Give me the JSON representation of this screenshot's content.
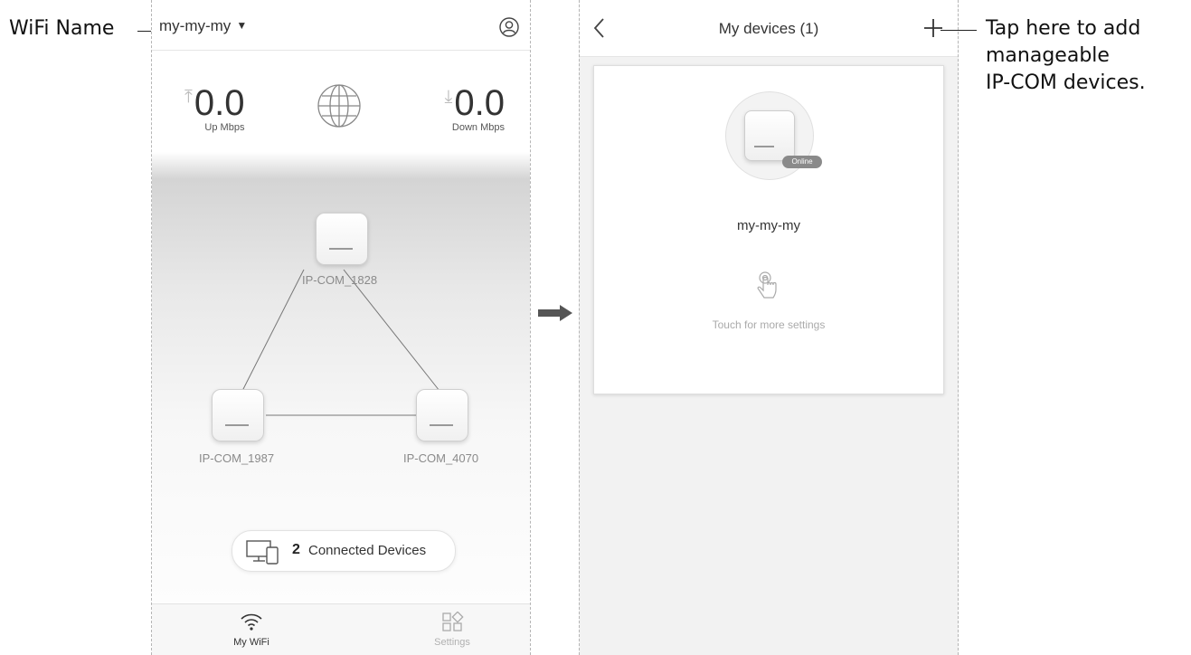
{
  "annotations": {
    "wifi_name_label": "WiFi Name",
    "add_callout": [
      "Tap here to add",
      "manageable",
      "IP-COM devices."
    ]
  },
  "home_screen": {
    "wifi_name": "my-my-my",
    "up_value": "0.0",
    "up_label": "Up Mbps",
    "down_value": "0.0",
    "down_label": "Down Mbps",
    "nodes": [
      {
        "label": "IP-COM_1828"
      },
      {
        "label": "IP-COM_1987"
      },
      {
        "label": "IP-COM_4070"
      }
    ],
    "connected_count": "2",
    "connected_label": "Connected Devices",
    "tabs": [
      {
        "label": "My WiFi",
        "icon": "wifi-icon",
        "active": true
      },
      {
        "label": "Settings",
        "icon": "grid-settings-icon",
        "active": false
      }
    ]
  },
  "devices_screen": {
    "title": "My devices (1)",
    "device": {
      "name": "my-my-my",
      "status": "Online",
      "hint": "Touch for more settings"
    }
  },
  "colors": {
    "text": "#333333",
    "muted": "#8a8a8a",
    "badge": "#8a8a8a"
  }
}
